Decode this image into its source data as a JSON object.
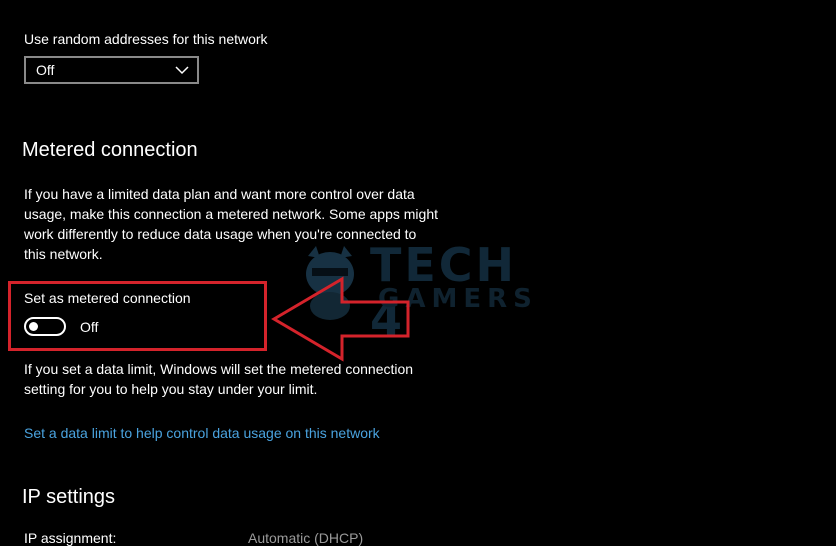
{
  "random_addresses": {
    "label": "Use random addresses for this network",
    "dropdown_value": "Off"
  },
  "metered": {
    "title": "Metered connection",
    "description": [
      "If you have a limited data plan and want more control over data",
      "usage, make this connection a metered network. Some apps might",
      "work differently to reduce data usage when you're connected to",
      "this network."
    ],
    "toggle_label": "Set as metered connection",
    "toggle_state": "Off",
    "data_limit_text": [
      "If you set a data limit, Windows will set the metered connection",
      "setting for you to help you stay under your limit."
    ],
    "link": "Set a data limit to help control data usage on this network"
  },
  "ip_settings": {
    "title": "IP settings",
    "assignment_label": "IP assignment:",
    "assignment_value": "Automatic (DHCP)"
  },
  "watermark": {
    "line1": "TECH 4",
    "line2": "GAMERS"
  },
  "colors": {
    "background": "#000000",
    "link": "#4aa3df",
    "highlight": "#d4232b"
  },
  "icons": [
    "chevron-down-icon",
    "arrow-left-icon",
    "mascot-logo"
  ]
}
